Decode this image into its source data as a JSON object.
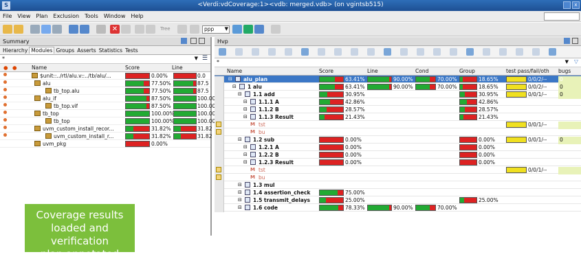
{
  "window": {
    "title": "<Verdi:vdCoverage:1><vdb: merged.vdb> (on vgintsb515)",
    "sys_icon": "S",
    "close_glyph": "x"
  },
  "menu": [
    "File",
    "View",
    "Plan",
    "Exclusion",
    "Tools",
    "Window",
    "Help"
  ],
  "toolbar": {
    "tree_label": "Tree",
    "combo_value": "ppp"
  },
  "left": {
    "header": "Summary",
    "tabs": [
      "Hierarchy",
      "Modules",
      "Groups",
      "Asserts",
      "Statistics",
      "Tests"
    ],
    "active_tab": "Modules",
    "filter": "*",
    "columns": {
      "name": "Name",
      "score": "Score",
      "line": "Line"
    },
    "rows": [
      {
        "name": "$unit::../rtl/alu.v::../tb/alu/...",
        "score": "0.00%",
        "score_pct": 0,
        "line": "0.0",
        "line_pct": 0
      },
      {
        "name": "alu",
        "score": "77.50%",
        "score_pct": 77.5,
        "line": "87.5",
        "line_pct": 87.5
      },
      {
        "name": "tb_top.alu",
        "score": "77.50%",
        "score_pct": 77.5,
        "line": "87.5",
        "line_pct": 87.5
      },
      {
        "name": "alu_if",
        "score": "87.50%",
        "score_pct": 87.5,
        "line": "100.00",
        "line_pct": 100
      },
      {
        "name": "tb_top.vif",
        "score": "87.50%",
        "score_pct": 87.5,
        "line": "100.00",
        "line_pct": 100
      },
      {
        "name": "tb_top",
        "score": "100.00%",
        "score_pct": 100,
        "line": "100.00",
        "line_pct": 100
      },
      {
        "name": "tb_top",
        "score": "100.00%",
        "score_pct": 100,
        "line": "100.00",
        "line_pct": 100
      },
      {
        "name": "uvm_custom_install_recor...",
        "score": "31.82%",
        "score_pct": 31.82,
        "line": "31.82",
        "line_pct": 31.82
      },
      {
        "name": "uvm_custom_install_r...",
        "score": "31.82%",
        "score_pct": 31.82,
        "line": "31.82",
        "line_pct": 31.82
      },
      {
        "name": "uvm_pkg",
        "score": "0.00%",
        "score_pct": 0,
        "line": "",
        "line_pct": null
      }
    ]
  },
  "banner": {
    "line1": "Coverage results",
    "line2": "loaded and verification",
    "line3": "plan annotated"
  },
  "right": {
    "header": "Hvp",
    "filter": "*",
    "columns": {
      "name": "Name",
      "score": "Score",
      "line": "Line",
      "cond": "Cond",
      "group": "Group",
      "test": "test pass/fail/oth",
      "bugs": "bugs"
    },
    "rows": [
      {
        "name": "alu_plan",
        "score": "63.41%",
        "score_pct": 63.41,
        "line": "90.00%",
        "line_pct": 90,
        "cond": "70.00%",
        "cond_pct": 70,
        "group": "18.65%",
        "group_pct": 18.65,
        "test": "0/0/2/--",
        "bugs": "0",
        "sel": true
      },
      {
        "name": "1 alu",
        "score": "63.41%",
        "score_pct": 63.41,
        "line": "90.00%",
        "line_pct": 90,
        "cond": "70.00%",
        "cond_pct": 70,
        "group": "18.65%",
        "group_pct": 18.65,
        "test": "0/0/2/--",
        "bugs": "0"
      },
      {
        "name": "1.1 add",
        "score": "30.95%",
        "score_pct": 30.95,
        "group": "30.95%",
        "group_pct": 30.95,
        "test": "0/0/1/--",
        "bugs": "0"
      },
      {
        "name": "1.1.1 A",
        "score": "42.86%",
        "score_pct": 42.86,
        "group": "42.86%",
        "group_pct": 42.86
      },
      {
        "name": "1.1.2 B",
        "score": "28.57%",
        "score_pct": 28.57,
        "group": "28.57%",
        "group_pct": 28.57
      },
      {
        "name": "1.1.3 Result",
        "score": "21.43%",
        "score_pct": 21.43,
        "group": "21.43%",
        "group_pct": 21.43
      },
      {
        "name": "tst",
        "test": "0/0/1/--"
      },
      {
        "name": "bu"
      },
      {
        "name": "1.2 sub",
        "score": "0.00%",
        "score_pct": 0,
        "group": "0.00%",
        "group_pct": 0,
        "test": "0/0/1/--",
        "bugs": "0"
      },
      {
        "name": "1.2.1 A",
        "score": "0.00%",
        "score_pct": 0,
        "group": "0.00%",
        "group_pct": 0
      },
      {
        "name": "1.2.2 B",
        "score": "0.00%",
        "score_pct": 0,
        "group": "0.00%",
        "group_pct": 0
      },
      {
        "name": "1.2.3 Result",
        "score": "0.00%",
        "score_pct": 0,
        "group": "0.00%",
        "group_pct": 0
      },
      {
        "name": "tst",
        "test": "0/0/1/--"
      },
      {
        "name": "bu"
      },
      {
        "name": "1.3 mul"
      },
      {
        "name": "1.4 assertion_check",
        "score": "75.00%",
        "score_pct": 75
      },
      {
        "name": "1.5 transmit_delays",
        "score": "25.00%",
        "score_pct": 25,
        "group": "25.00%",
        "group_pct": 25
      },
      {
        "name": "1.6 code",
        "score": "78.33%",
        "score_pct": 78.33,
        "line": "90.00%",
        "line_pct": 90,
        "cond": "70.00%",
        "cond_pct": 70
      }
    ]
  },
  "colors": {
    "accent": "#2e6eb8",
    "banner": "#7cbf3c",
    "bar_red": "#d22222",
    "bar_green": "#22aa33",
    "bar_yellow": "#f0e020"
  }
}
